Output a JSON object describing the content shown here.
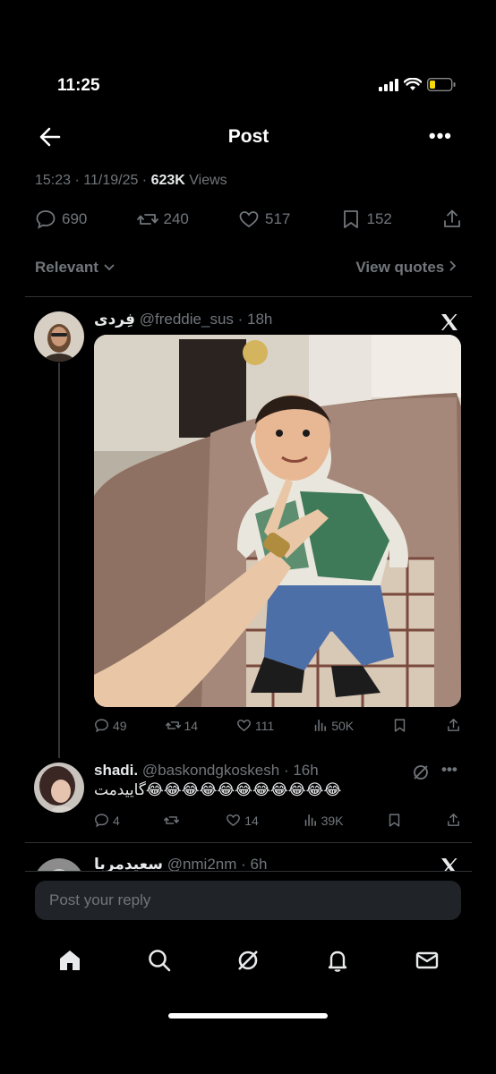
{
  "status_bar": {
    "time": "11:25"
  },
  "header": {
    "title": "Post"
  },
  "post_meta": {
    "time": "15:23",
    "date": "11/19/25",
    "views": "623K",
    "views_label": "Views"
  },
  "post_actions": {
    "replies": "690",
    "reposts": "240",
    "likes": "517",
    "bookmarks": "152"
  },
  "sort": {
    "relevance_label": "Relevant",
    "view_quotes_label": "View quotes"
  },
  "replies": [
    {
      "name": "فِردی",
      "handle": "@freddie_sus",
      "time": "18h",
      "metrics": {
        "replies": "49",
        "reposts": "14",
        "likes": "111",
        "views": "50K"
      }
    },
    {
      "name": "shadi.",
      "handle": "@baskondgkoskesh",
      "time": "16h",
      "text": "گاییدمت😂😂😂😂😂😂😂😂😂😂😂",
      "metrics": {
        "replies": "4",
        "reposts": "",
        "likes": "14",
        "views": "39K"
      }
    },
    {
      "name": "سعیدمربا",
      "handle": "@nmi2nm",
      "time": "6h"
    }
  ],
  "composer": {
    "placeholder": "Post your reply"
  },
  "tabbar": {
    "items": [
      "home-icon",
      "search-icon",
      "grok-icon",
      "bell-icon",
      "mail-icon"
    ]
  },
  "colors": {
    "background": "#000000",
    "secondary_text": "#71767b",
    "primary_text": "#e7e9ea",
    "battery": "#f5d90a"
  }
}
